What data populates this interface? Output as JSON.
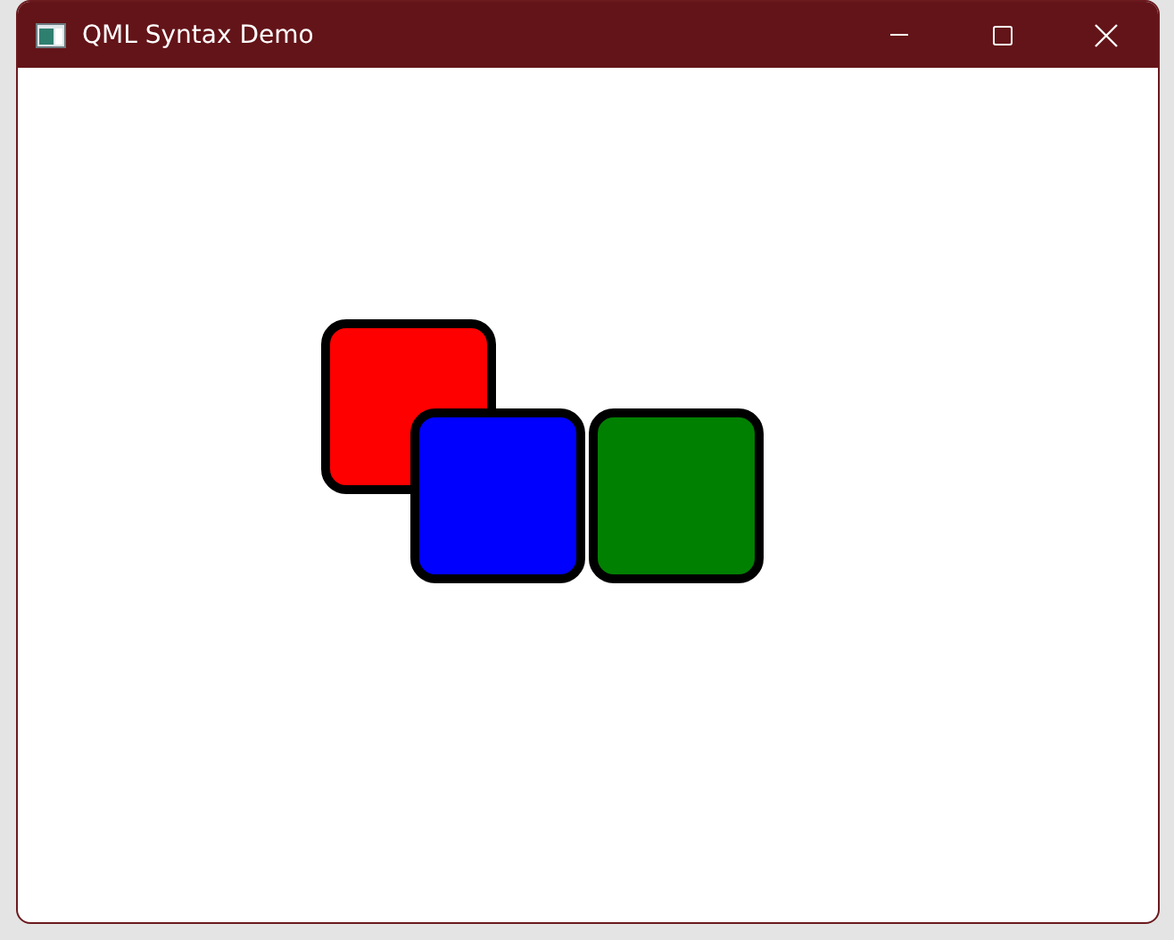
{
  "window": {
    "title": "QML Syntax Demo"
  },
  "squares": [
    {
      "color": "#ff0000"
    },
    {
      "color": "#0000ff"
    },
    {
      "color": "#008000"
    }
  ]
}
